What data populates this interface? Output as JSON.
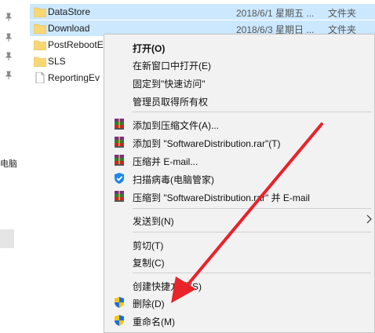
{
  "nav": {
    "partial_label": "电脑"
  },
  "files": [
    {
      "name": "DataStore",
      "date": "2018/6/1 星期五 ...",
      "type": "文件夹",
      "icon": "folder-icon",
      "selected": true
    },
    {
      "name": "Download",
      "date": "2018/6/3 星期日 ...",
      "type": "文件夹",
      "icon": "folder-icon",
      "selected": true
    },
    {
      "name": "PostRebootE",
      "date": "",
      "type": "",
      "icon": "folder-icon",
      "selected": false
    },
    {
      "name": "SLS",
      "date": "",
      "type": "",
      "icon": "folder-icon",
      "selected": false
    },
    {
      "name": "ReportingEv",
      "date": "",
      "type": "",
      "icon": "file-icon",
      "selected": false
    }
  ],
  "menu": {
    "open": "打开(O)",
    "open_new_window": "在新窗口中打开(E)",
    "pin_quick_access": "固定到\"快速访问\"",
    "take_ownership": "管理员取得所有权",
    "add_to_archive": "添加到压缩文件(A)...",
    "add_to_rar": "添加到 \"SoftwareDistribution.rar\"(T)",
    "compress_email": "压缩并 E-mail...",
    "virus_scan": "扫描病毒(电脑管家)",
    "compress_rar_email": "压缩到 \"SoftwareDistribution.rar\" 并 E-mail",
    "send_to": "发送到(N)",
    "cut": "剪切(T)",
    "copy": "复制(C)",
    "create_shortcut": "创建快捷方式(S)",
    "delete": "删除(D)",
    "rename": "重命名(M)"
  },
  "colors": {
    "selection": "#cce8ff",
    "menu_bg": "#f2f2f2",
    "folder": "#f8d775",
    "annotation_arrow": "#e8232a"
  }
}
